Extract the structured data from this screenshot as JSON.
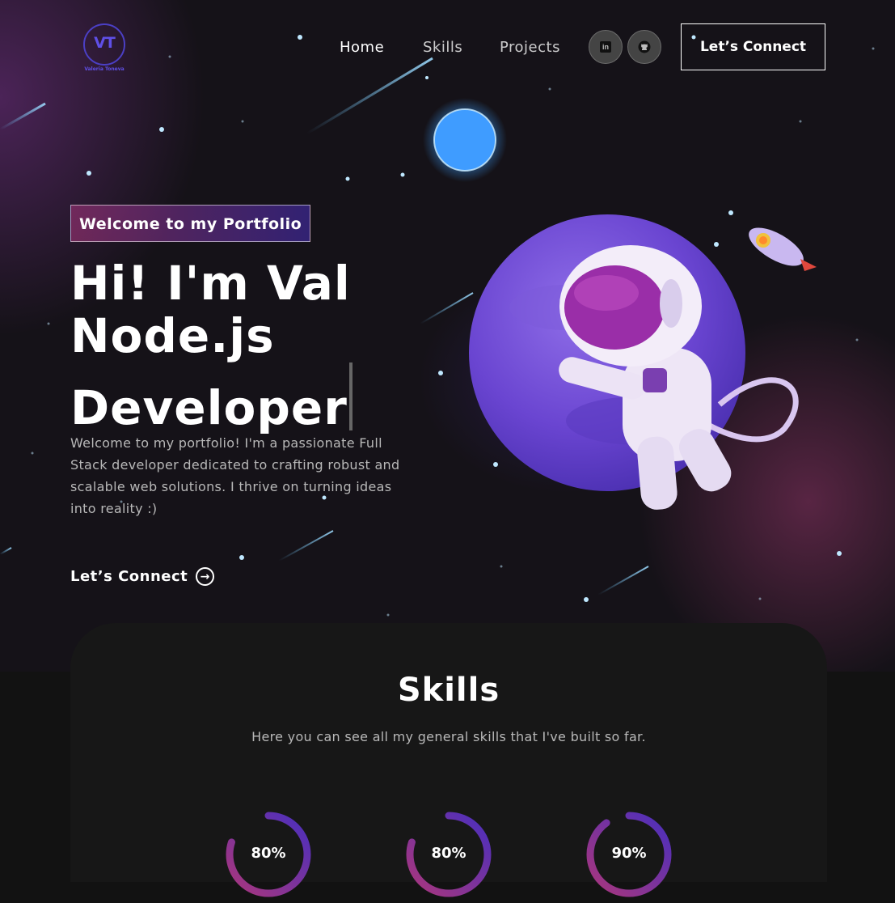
{
  "header": {
    "logo_text": "VT",
    "logo_subtext": "Valeria Toneva",
    "nav": [
      {
        "label": "Home"
      },
      {
        "label": "Skills"
      },
      {
        "label": "Projects"
      }
    ],
    "social": [
      {
        "icon": "linkedin-icon",
        "glyph": "in"
      },
      {
        "icon": "github-icon",
        "glyph": "GH"
      }
    ],
    "connect_label": "Let’s Connect"
  },
  "hero": {
    "tagline": "Welcome to my Portfolio",
    "headline_line1": "Hi! I'm Val",
    "headline_line2": "Node.js",
    "headline_line3": "Developer",
    "intro": "Welcome to my portfolio! I'm a passionate Full Stack developer dedicated to crafting robust and scalable web solutions. I thrive on turning ideas into reality :)",
    "cta_label": "Let’s Connect"
  },
  "skills": {
    "title": "Skills",
    "subtitle": "Here you can see all my general skills that I've built so far.",
    "meters": [
      {
        "label": "80%",
        "value": 0.8
      },
      {
        "label": "80%",
        "value": 0.8
      },
      {
        "label": "90%",
        "value": 0.9
      }
    ]
  },
  "colors": {
    "accent_purple": "#4a2fbd",
    "accent_pink": "#aa367c",
    "background": "#121212"
  }
}
